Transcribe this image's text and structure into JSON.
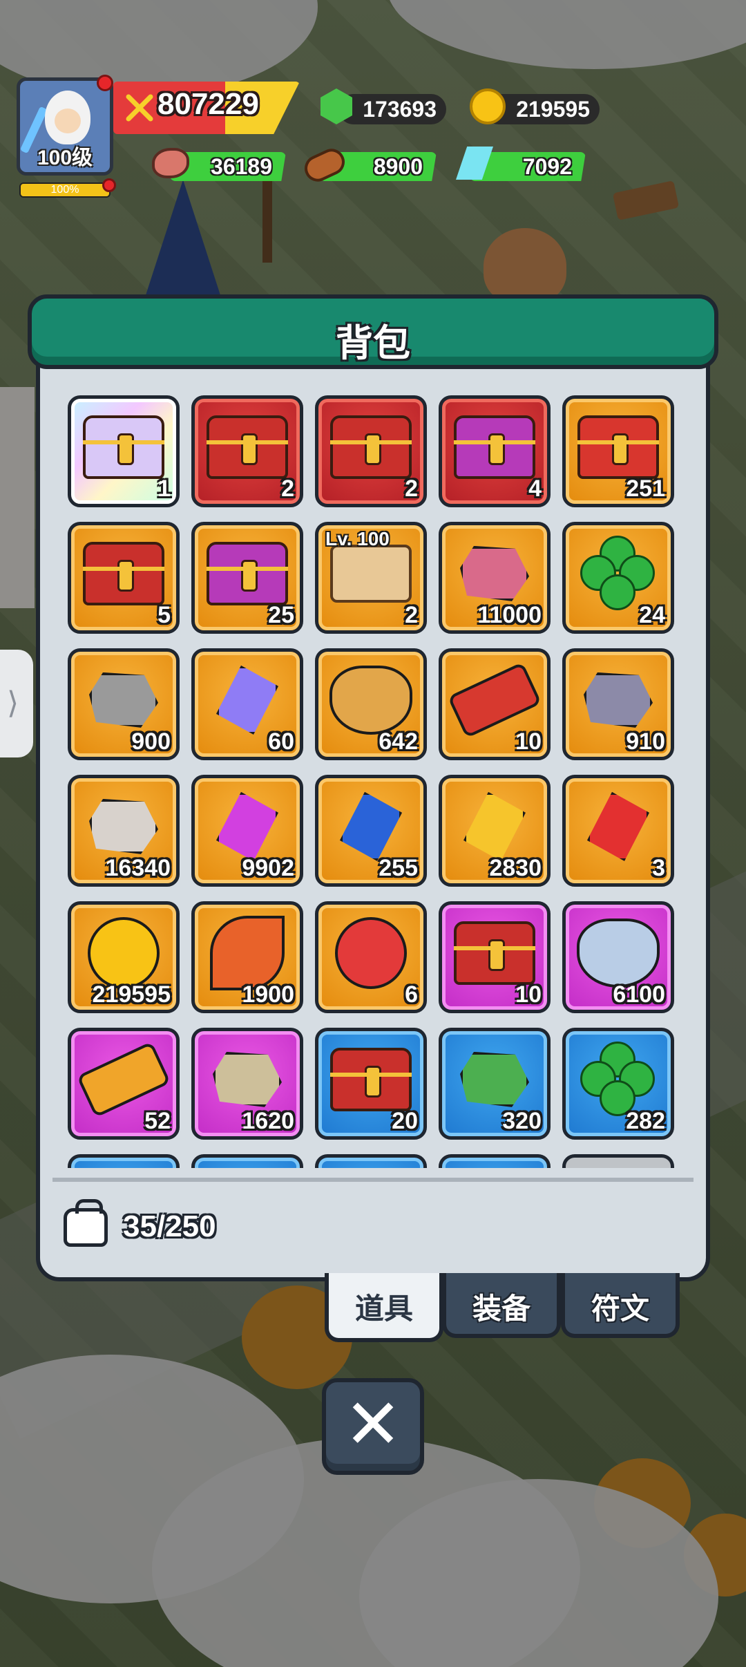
{
  "player": {
    "level_label": "100级",
    "xp_percent_label": "100%",
    "xp_fraction": 1.0,
    "power": "807229"
  },
  "currencies": {
    "gems": "173693",
    "gold": "219595"
  },
  "resources": {
    "meat": "36189",
    "wood": "8900",
    "crystal": "7092"
  },
  "panel": {
    "title": "背包",
    "capacity": "35/250"
  },
  "items": [
    {
      "count": "1",
      "rarity": "rainbow",
      "kind": "chest-icon",
      "color": "#d9c8f7"
    },
    {
      "count": "2",
      "rarity": "red",
      "kind": "chest-icon",
      "color": "#c9302c"
    },
    {
      "count": "2",
      "rarity": "red",
      "kind": "chest-icon",
      "color": "#c9302c"
    },
    {
      "count": "4",
      "rarity": "red",
      "kind": "chest-icon",
      "color": "#b63ab9"
    },
    {
      "count": "251",
      "rarity": "orange",
      "kind": "chest-icon",
      "color": "#d8362e"
    },
    {
      "count": "5",
      "rarity": "orange",
      "kind": "chest-icon",
      "color": "#c9302c"
    },
    {
      "count": "25",
      "rarity": "orange",
      "kind": "chest-icon",
      "color": "#b63ab9"
    },
    {
      "count": "2",
      "rarity": "orange",
      "kind": "scroll-icon",
      "color": "#e8c896",
      "level_label": "Lv. 100"
    },
    {
      "count": "11000",
      "rarity": "orange",
      "kind": "ore-icon",
      "color": "#d96a8a"
    },
    {
      "count": "24",
      "rarity": "orange",
      "kind": "clover-icon",
      "color": "#2fb342"
    },
    {
      "count": "900",
      "rarity": "orange",
      "kind": "ore-icon",
      "color": "#9a9a9a"
    },
    {
      "count": "60",
      "rarity": "orange",
      "kind": "crystal-icon",
      "color": "#8f7cf5"
    },
    {
      "count": "642",
      "rarity": "orange",
      "kind": "badge-icon",
      "color": "#e2a64a"
    },
    {
      "count": "10",
      "rarity": "orange",
      "kind": "ticket-icon",
      "color": "#d7392f"
    },
    {
      "count": "910",
      "rarity": "orange",
      "kind": "rune-stone-icon",
      "color": "#8c8aa8"
    },
    {
      "count": "16340",
      "rarity": "orange",
      "kind": "rune-stone-icon",
      "color": "#d8d2cc"
    },
    {
      "count": "9902",
      "rarity": "orange",
      "kind": "gem-icon",
      "color": "#d240e0"
    },
    {
      "count": "255",
      "rarity": "orange",
      "kind": "crystal-icon",
      "color": "#2a63d8"
    },
    {
      "count": "2830",
      "rarity": "orange",
      "kind": "crystal-icon",
      "color": "#f6c52c"
    },
    {
      "count": "3",
      "rarity": "orange",
      "kind": "crystal-icon",
      "color": "#e33030"
    },
    {
      "count": "219595",
      "rarity": "orange",
      "kind": "coin-icon",
      "color": "#f8c315"
    },
    {
      "count": "1900",
      "rarity": "orange",
      "kind": "leaf-icon",
      "color": "#e8622a"
    },
    {
      "count": "6",
      "rarity": "orange",
      "kind": "flower-icon",
      "color": "#e33a3a"
    },
    {
      "count": "10",
      "rarity": "purple",
      "kind": "chest-icon",
      "color": "#c9302c"
    },
    {
      "count": "6100",
      "rarity": "purple",
      "kind": "badge-icon",
      "color": "#b9cde6"
    },
    {
      "count": "52",
      "rarity": "purple",
      "kind": "ticket-icon",
      "color": "#f0a52a"
    },
    {
      "count": "1620",
      "rarity": "purple",
      "kind": "rune-stone-icon",
      "color": "#cdbf9a"
    },
    {
      "count": "20",
      "rarity": "blue",
      "kind": "chest-icon",
      "color": "#c9302c"
    },
    {
      "count": "320",
      "rarity": "blue",
      "kind": "rune-stone-icon",
      "color": "#4caf50"
    },
    {
      "count": "282",
      "rarity": "blue",
      "kind": "clover-icon",
      "color": "#2fb342"
    },
    {
      "count": "",
      "rarity": "blue",
      "kind": "",
      "color": ""
    },
    {
      "count": "",
      "rarity": "blue",
      "kind": "",
      "color": ""
    },
    {
      "count": "",
      "rarity": "blue",
      "kind": "",
      "color": ""
    },
    {
      "count": "",
      "rarity": "blue",
      "kind": "",
      "color": ""
    },
    {
      "count": "",
      "rarity": "gray",
      "kind": "",
      "color": ""
    }
  ],
  "tabs": [
    {
      "label": "道具",
      "active": true
    },
    {
      "label": "装备",
      "active": false
    },
    {
      "label": "符文",
      "active": false
    }
  ],
  "close_label": "✕"
}
